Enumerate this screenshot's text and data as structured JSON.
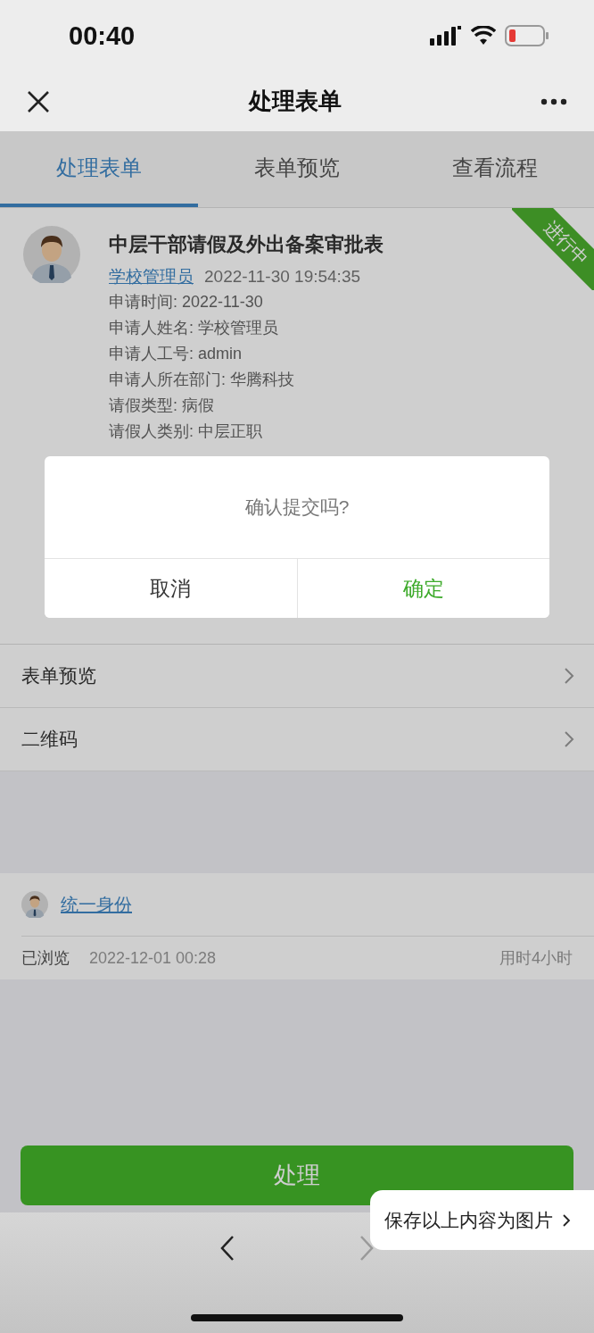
{
  "status_bar": {
    "time": "00:40"
  },
  "nav": {
    "title": "处理表单"
  },
  "tabs": [
    {
      "label": "处理表单",
      "selected": true
    },
    {
      "label": "表单预览",
      "selected": false
    },
    {
      "label": "查看流程",
      "selected": false
    }
  ],
  "form": {
    "title": "中层干部请假及外出备案审批表",
    "submitter": "学校管理员",
    "submitted_at": "2022-11-30 19:54:35",
    "status": "进行中",
    "fields": [
      "申请时间: 2022-11-30",
      "申请人姓名: 学校管理员",
      "申请人工号: admin",
      "申请人所在部门: 华腾科技",
      "请假类型: 病假",
      "请假人类别: 中层正职"
    ]
  },
  "links": [
    {
      "label": "表单预览"
    },
    {
      "label": "二维码"
    }
  ],
  "viewer": {
    "name": "统一身份",
    "action": "已浏览",
    "time": "2022-12-01 00:28",
    "duration": "用时4小时"
  },
  "action_button": "处理",
  "dialog": {
    "message": "确认提交吗?",
    "buttons": [
      {
        "label": "取消",
        "kind": "cancel"
      },
      {
        "label": "确定",
        "kind": "confirm"
      }
    ]
  },
  "save_popup": "保存以上内容为图片",
  "toolbar": {
    "back_enabled": true,
    "forward_enabled": false
  }
}
